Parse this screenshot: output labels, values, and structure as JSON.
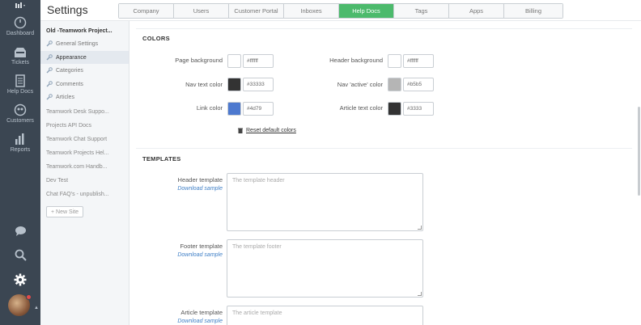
{
  "app": {
    "title": "Settings"
  },
  "nav": {
    "items": [
      {
        "label": "Dashboard",
        "icon": "dashboard-icon"
      },
      {
        "label": "Tickets",
        "icon": "tickets-icon"
      },
      {
        "label": "Help Docs",
        "icon": "help-docs-icon"
      },
      {
        "label": "Customers",
        "icon": "customers-icon"
      },
      {
        "label": "Reports",
        "icon": "reports-icon"
      }
    ],
    "bottom_icons": [
      "chat-icon",
      "search-icon",
      "settings-gear-icon"
    ]
  },
  "tabs": [
    {
      "label": "Company",
      "active": false
    },
    {
      "label": "Users",
      "active": false
    },
    {
      "label": "Customer Portal",
      "active": false
    },
    {
      "label": "Inboxes",
      "active": false
    },
    {
      "label": "Help Docs",
      "active": true
    },
    {
      "label": "Tags",
      "active": false
    },
    {
      "label": "Apps",
      "active": false
    },
    {
      "label": "Billing",
      "active": false
    }
  ],
  "sidebar": {
    "site_title": "Old -Teamwork Project...",
    "sub_items": [
      {
        "label": "General Settings"
      },
      {
        "label": "Appearance"
      },
      {
        "label": "Categories"
      },
      {
        "label": "Comments"
      },
      {
        "label": "Articles"
      }
    ],
    "sites": [
      "Teamwork Desk Suppo...",
      "Projects API Docs",
      "Teamwork Chat Support",
      "Teamwork Projects Hel...",
      "Teamwork.com Handb...",
      "Dev Test",
      "Chat FAQ's - unpublish..."
    ],
    "new_site_label": "+ New Site"
  },
  "colors_section": {
    "title": "COLORS",
    "fields": [
      {
        "label": "Page background",
        "swatch": "#ffffff",
        "value": "#ffffff"
      },
      {
        "label": "Header background",
        "swatch": "#ffffff",
        "value": "#ffffff"
      },
      {
        "label": "Nav text color",
        "swatch": "#333333",
        "value": "#33333"
      },
      {
        "label": "Nav 'active' color",
        "swatch": "#b5b5b5",
        "value": "#b5b5"
      },
      {
        "label": "Link color",
        "swatch": "#4d79cf",
        "value": "#4d79"
      },
      {
        "label": "Article text color",
        "swatch": "#333333",
        "value": "#3333"
      }
    ],
    "reset_label": "Reset default colors"
  },
  "templates_section": {
    "title": "TEMPLATES",
    "fields": [
      {
        "label": "Header template",
        "link": "Download sample",
        "placeholder": "The template header"
      },
      {
        "label": "Footer template",
        "link": "Download sample",
        "placeholder": "The template footer"
      },
      {
        "label": "Article template",
        "link": "Download sample",
        "placeholder": "The article template"
      }
    ]
  },
  "theme": {
    "active_tab": "#4cba6c",
    "nav_bg": "#3b4652",
    "link": "#3f7fc6"
  }
}
